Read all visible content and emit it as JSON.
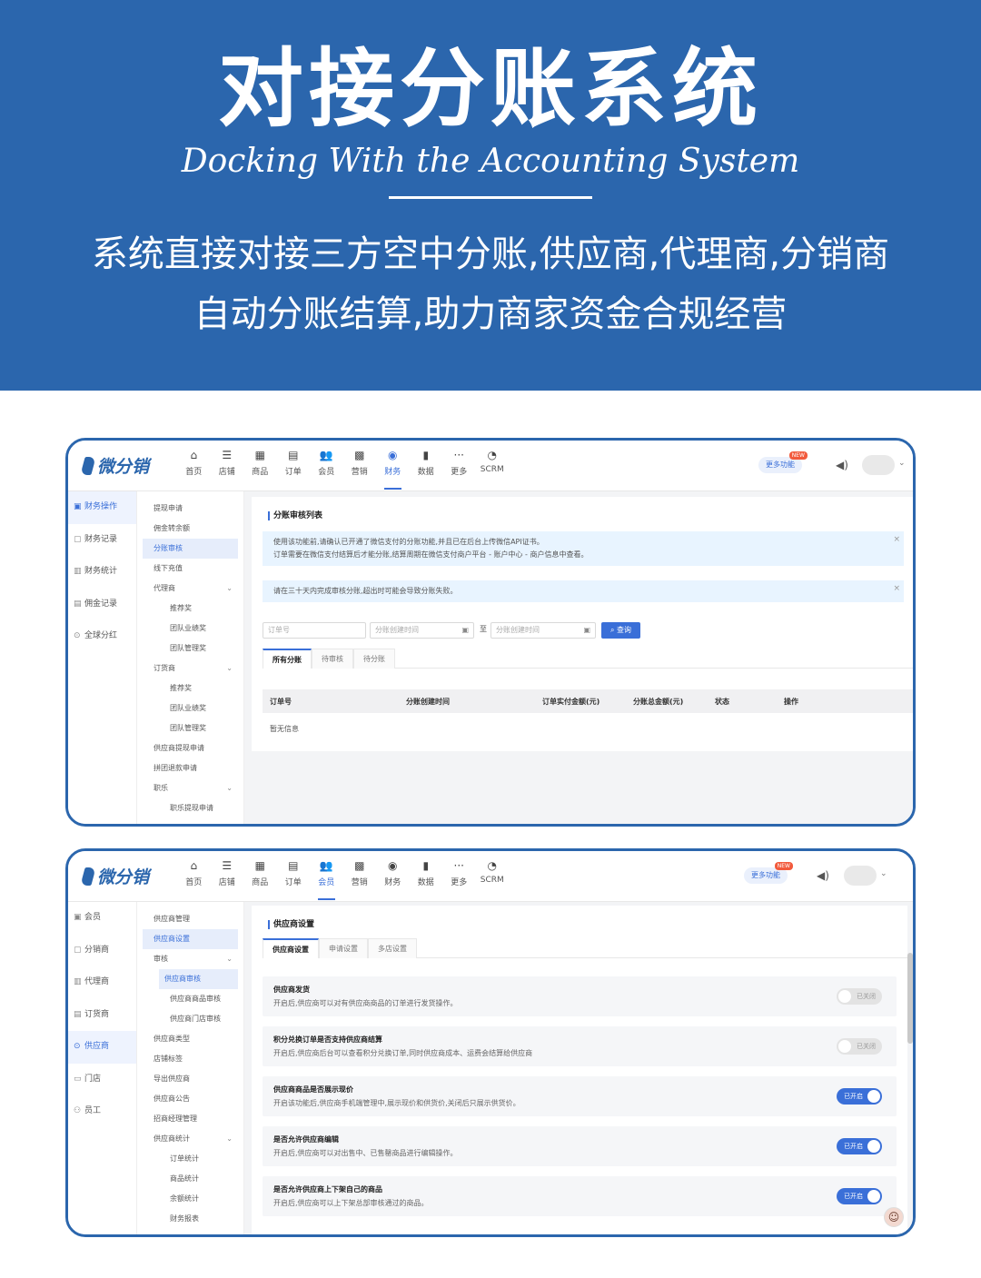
{
  "hero": {
    "title": "对接分账系统",
    "subtitle": "Docking With the Accounting System",
    "desc_line1": "系统直接对接三方空中分账,供应商,代理商,分销商",
    "desc_line2": "自动分账结算,助力商家资金合规经营"
  },
  "app": {
    "logo": "微分销",
    "more_func": "更多功能",
    "more_func_badge": "NEW",
    "nav": [
      {
        "label": "首页",
        "icon": "home-icon",
        "glyph": "⌂"
      },
      {
        "label": "店铺",
        "icon": "store-icon",
        "glyph": "☰"
      },
      {
        "label": "商品",
        "icon": "goods-icon",
        "glyph": "▦"
      },
      {
        "label": "订单",
        "icon": "order-icon",
        "glyph": "▤"
      },
      {
        "label": "会员",
        "icon": "member-icon",
        "glyph": "👥"
      },
      {
        "label": "营销",
        "icon": "marketing-icon",
        "glyph": "▩"
      },
      {
        "label": "财务",
        "icon": "finance-icon",
        "glyph": "◉"
      },
      {
        "label": "数据",
        "icon": "data-icon",
        "glyph": "▮"
      },
      {
        "label": "更多",
        "icon": "more-icon",
        "glyph": "···"
      },
      {
        "label": "SCRM",
        "icon": "scrm-icon",
        "glyph": "◔"
      }
    ]
  },
  "shot1": {
    "active_nav": "财务",
    "side1": [
      {
        "label": "财务操作",
        "icon": "finance-op-icon",
        "active": true
      },
      {
        "label": "财务记录",
        "icon": "finance-record-icon",
        "active": false
      },
      {
        "label": "财务统计",
        "icon": "finance-stats-icon",
        "active": false
      },
      {
        "label": "佣金记录",
        "icon": "commission-record-icon",
        "active": false
      },
      {
        "label": "全球分红",
        "icon": "global-dividend-icon",
        "active": false
      }
    ],
    "side2": [
      {
        "label": "提现申请",
        "sub": false,
        "active": false,
        "chev": false
      },
      {
        "label": "佣金转余额",
        "sub": false,
        "active": false,
        "chev": false
      },
      {
        "label": "分账审核",
        "sub": false,
        "active": true,
        "chev": false
      },
      {
        "label": "线下充值",
        "sub": false,
        "active": false,
        "chev": false
      },
      {
        "label": "代理商",
        "sub": false,
        "active": false,
        "chev": true
      },
      {
        "label": "推荐奖",
        "sub": true,
        "active": false,
        "chev": false
      },
      {
        "label": "团队业绩奖",
        "sub": true,
        "active": false,
        "chev": false
      },
      {
        "label": "团队管理奖",
        "sub": true,
        "active": false,
        "chev": false
      },
      {
        "label": "订货商",
        "sub": false,
        "active": false,
        "chev": true
      },
      {
        "label": "推荐奖",
        "sub": true,
        "active": false,
        "chev": false
      },
      {
        "label": "团队业绩奖",
        "sub": true,
        "active": false,
        "chev": false
      },
      {
        "label": "团队管理奖",
        "sub": true,
        "active": false,
        "chev": false
      },
      {
        "label": "供应商提现申请",
        "sub": false,
        "active": false,
        "chev": false
      },
      {
        "label": "拼团退款申请",
        "sub": false,
        "active": false,
        "chev": false
      },
      {
        "label": "职乐",
        "sub": false,
        "active": false,
        "chev": true
      },
      {
        "label": "职乐提现申请",
        "sub": true,
        "active": false,
        "chev": false
      }
    ],
    "panel_title": "分账审核列表",
    "alert1_line1": "使用该功能前,请确认已开通了微信支付的分账功能,并且已在后台上传微信API证书。",
    "alert1_line2": "订单需要在微信支付结算后才能分账,结算周期在微信支付商户平台 - 账户中心 - 商户信息中查看。",
    "alert2": "请在三十天内完成审核分账,超出时可能会导致分账失败。",
    "close_glyph": "×",
    "order_placeholder": "订单号",
    "start_placeholder": "分账创建时间",
    "end_placeholder": "分账创建时间",
    "to_label": "至",
    "query_label": "查询",
    "tabs": [
      "所有分账",
      "待审核",
      "待分账"
    ],
    "columns": [
      "订单号",
      "分账创建时间",
      "订单实付金额(元)",
      "分账总金额(元)",
      "状态",
      "操作"
    ],
    "empty_text": "暂无信息"
  },
  "shot2": {
    "active_nav": "会员",
    "side1": [
      {
        "label": "会员",
        "icon": "member-icon",
        "active": false
      },
      {
        "label": "分销商",
        "icon": "distributor-icon",
        "active": false
      },
      {
        "label": "代理商",
        "icon": "agent-icon",
        "active": false
      },
      {
        "label": "订货商",
        "icon": "orderer-icon",
        "active": false
      },
      {
        "label": "供应商",
        "icon": "supplier-icon",
        "active": true
      },
      {
        "label": "门店",
        "icon": "shop-icon",
        "active": false
      },
      {
        "label": "员工",
        "icon": "staff-icon",
        "active": false
      }
    ],
    "side2": [
      {
        "label": "供应商管理",
        "sub": false,
        "active": false,
        "chev": false
      },
      {
        "label": "供应商设置",
        "sub": false,
        "active": true,
        "chev": false
      },
      {
        "label": "审核",
        "sub": false,
        "active": false,
        "chev": true
      },
      {
        "label": "供应商审核",
        "sub": true,
        "active": true,
        "chev": false
      },
      {
        "label": "供应商商品审核",
        "sub": true,
        "active": false,
        "chev": false
      },
      {
        "label": "供应商门店审核",
        "sub": true,
        "active": false,
        "chev": false
      },
      {
        "label": "供应商类型",
        "sub": false,
        "active": false,
        "chev": false
      },
      {
        "label": "店铺标签",
        "sub": false,
        "active": false,
        "chev": false
      },
      {
        "label": "导出供应商",
        "sub": false,
        "active": false,
        "chev": false
      },
      {
        "label": "供应商公告",
        "sub": false,
        "active": false,
        "chev": false
      },
      {
        "label": "招商经理管理",
        "sub": false,
        "active": false,
        "chev": false
      },
      {
        "label": "供应商统计",
        "sub": false,
        "active": false,
        "chev": true
      },
      {
        "label": "订单统计",
        "sub": true,
        "active": false,
        "chev": false
      },
      {
        "label": "商品统计",
        "sub": true,
        "active": false,
        "chev": false
      },
      {
        "label": "余额统计",
        "sub": true,
        "active": false,
        "chev": false
      },
      {
        "label": "财务报表",
        "sub": true,
        "active": false,
        "chev": false
      }
    ],
    "panel_title": "供应商设置",
    "tabs": [
      "供应商设置",
      "申请设置",
      "多店设置"
    ],
    "settings": [
      {
        "title": "供应商发货",
        "desc": "开启后,供应商可以对有供应商商品的订单进行发货操作。",
        "on": false,
        "state_label": "已关闭"
      },
      {
        "title": "积分兑换订单是否支持供应商结算",
        "desc": "开启后,供应商后台可以查看积分兑换订单,同时供应商成本、运费会结算给供应商",
        "on": false,
        "state_label": "已关闭"
      },
      {
        "title": "供应商商品是否展示现价",
        "desc": "开启该功能后,供应商手机端管理中,展示现价和供货价,关闭后只展示供货价。",
        "on": true,
        "state_label": "已开启"
      },
      {
        "title": "是否允许供应商编辑",
        "desc": "开启后,供应商可以对出售中、已售罄商品进行编辑操作。",
        "on": true,
        "state_label": "已开启"
      },
      {
        "title": "是否允许供应商上下架自己的商品",
        "desc": "开启后,供应商可以上下架总部审核通过的商品。",
        "on": true,
        "state_label": "已开启"
      }
    ],
    "float_avatar": "☺"
  },
  "colors": {
    "brand": "#2b66ad",
    "accent": "#3a6fd8"
  }
}
